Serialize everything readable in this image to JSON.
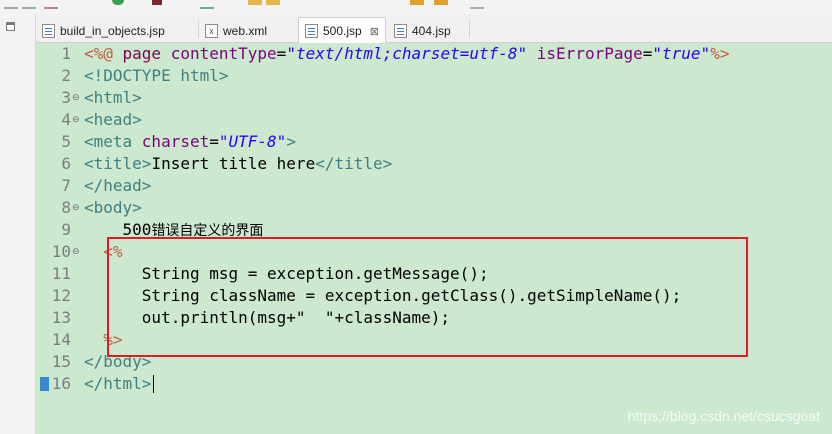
{
  "tabs": [
    {
      "label": "build_in_objects.jsp",
      "icon": "jsp-file-icon"
    },
    {
      "label": "web.xml",
      "icon": "xml-file-icon"
    },
    {
      "label": "500.jsp",
      "icon": "jsp-file-icon",
      "active": true,
      "close": "⊠"
    },
    {
      "label": "404.jsp",
      "icon": "jsp-file-icon"
    }
  ],
  "editor": {
    "line_numbers": [
      "1",
      "2",
      "3",
      "4",
      "5",
      "6",
      "7",
      "8",
      "9",
      "10",
      "11",
      "12",
      "13",
      "14",
      "15",
      "16"
    ],
    "fold_marks": {
      "3": "⊖",
      "4": "⊖",
      "8": "⊖",
      "10": "⊖"
    },
    "lines": [
      [
        {
          "t": "<%@ ",
          "c": "dir"
        },
        {
          "t": "page ",
          "c": "kw"
        },
        {
          "t": "contentType",
          "c": "attr"
        },
        {
          "t": "=",
          "c": "plain"
        },
        {
          "t": "\"text/html;charset=utf-8\"",
          "c": "str"
        },
        {
          "t": " ",
          "c": "plain"
        },
        {
          "t": "isErrorPage",
          "c": "attr"
        },
        {
          "t": "=",
          "c": "plain"
        },
        {
          "t": "\"true\"",
          "c": "str"
        },
        {
          "t": "%>",
          "c": "dir"
        }
      ],
      [
        {
          "t": "<!DOCTYPE html>",
          "c": "tag"
        }
      ],
      [
        {
          "t": "<html>",
          "c": "tag"
        }
      ],
      [
        {
          "t": "<head>",
          "c": "tag"
        }
      ],
      [
        {
          "t": "<meta ",
          "c": "tag"
        },
        {
          "t": "charset",
          "c": "attr"
        },
        {
          "t": "=",
          "c": "plain"
        },
        {
          "t": "\"UTF-8\"",
          "c": "str"
        },
        {
          "t": ">",
          "c": "tag"
        }
      ],
      [
        {
          "t": "<title>",
          "c": "tag"
        },
        {
          "t": "Insert title here",
          "c": "plain"
        },
        {
          "t": "</title>",
          "c": "tag"
        }
      ],
      [
        {
          "t": "</head>",
          "c": "tag"
        }
      ],
      [
        {
          "t": "<body>",
          "c": "tag"
        }
      ],
      [
        {
          "t": "    500",
          "c": "plain"
        },
        {
          "t": "错误自定义的界面",
          "c": "plain",
          "cn": true
        }
      ],
      [
        {
          "t": "  <%",
          "c": "dir"
        }
      ],
      [
        {
          "t": "      String msg = exception.getMessage();",
          "c": "plain"
        }
      ],
      [
        {
          "t": "      String className = exception.getClass().getSimpleName();",
          "c": "plain"
        }
      ],
      [
        {
          "t": "      out.println(msg+\"  \"+className);",
          "c": "plain"
        }
      ],
      [
        {
          "t": "  %>",
          "c": "dir"
        }
      ],
      [
        {
          "t": "</body>",
          "c": "tag"
        }
      ],
      [
        {
          "t": "</html>",
          "c": "tag"
        }
      ]
    ]
  },
  "watermark": "https://blog.csdn.net/csucsgoat",
  "colors": {
    "editor_bg": "#cce8cf",
    "annotation_box": "#e01b24"
  }
}
